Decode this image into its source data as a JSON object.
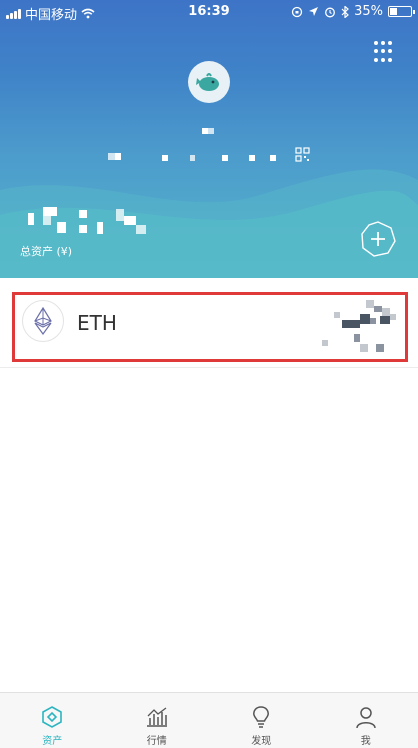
{
  "status_bar": {
    "carrier": "中国移动",
    "time": "16:39",
    "battery": "35%",
    "battery_level": 0.35
  },
  "wallet": {
    "total_label": "总资产 (¥)"
  },
  "assets": [
    {
      "symbol": "ETH"
    }
  ],
  "tabbar": {
    "tabs": [
      {
        "label": "资产",
        "active": true
      },
      {
        "label": "行情",
        "active": false
      },
      {
        "label": "发现",
        "active": false
      },
      {
        "label": "我",
        "active": false
      }
    ]
  },
  "colors": {
    "accent": "#2cb5c0",
    "highlight_border": "#e0393a",
    "header_top": "#3e74c7",
    "header_bottom": "#55b6c9"
  }
}
